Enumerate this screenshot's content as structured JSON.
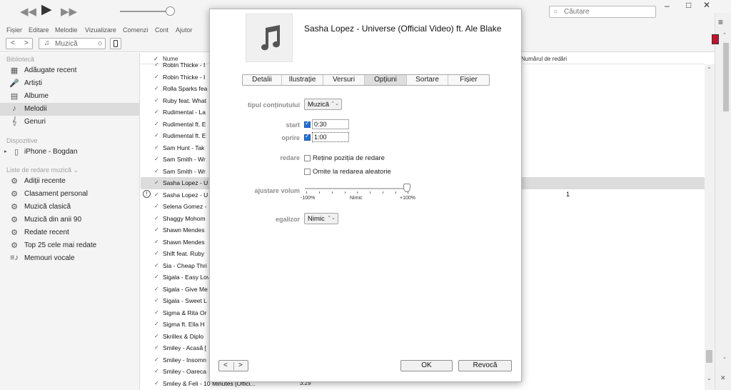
{
  "toolbar": {
    "prev_icon": "◀◀",
    "play_icon": "▶",
    "next_icon": "▶▶",
    "search_placeholder": "Căutare",
    "minimize": "–",
    "maximize": "□",
    "close": "✕"
  },
  "menu": [
    "Fișier",
    "Editare",
    "Melodie",
    "Vizualizare",
    "Comenzi",
    "Cont",
    "Ajutor"
  ],
  "nav": {
    "back": "<",
    "forward": ">",
    "media_select": "Muzică",
    "media_chevron": "◇"
  },
  "sidebar": {
    "library_title": "Bibliotecă",
    "library": [
      {
        "label": "Adăugate recent",
        "icon": "▦"
      },
      {
        "label": "Artiști",
        "icon": "🎤"
      },
      {
        "label": "Albume",
        "icon": "▤"
      },
      {
        "label": "Melodii",
        "icon": "♪"
      },
      {
        "label": "Genuri",
        "icon": "𝄞"
      }
    ],
    "devices_title": "Dispozitive",
    "device": {
      "label": "iPhone - Bogdan",
      "icon": "▯",
      "expand": "▸"
    },
    "playlists_title": "Liste de redare muzică ⌄",
    "playlists": [
      {
        "label": "Adiții recente",
        "icon": "⚙"
      },
      {
        "label": "Clasament personal",
        "icon": "⚙"
      },
      {
        "label": "Muzică clasică",
        "icon": "⚙"
      },
      {
        "label": "Muzică din anii 90",
        "icon": "⚙"
      },
      {
        "label": "Redate recent",
        "icon": "⚙"
      },
      {
        "label": "Top 25 cele mai redate",
        "icon": "⚙"
      },
      {
        "label": "Memouri vocale",
        "icon": "≡♪"
      }
    ]
  },
  "list": {
    "col_check": "✓",
    "col_name": "Nume",
    "col_plays": "Numărul de redări",
    "rows": [
      "Robin Thicke - I",
      "Robin Thicke - I",
      "Rolla Sparks fea",
      "Ruby feat. What",
      "Rudimental - La",
      "Rudimental ft. E",
      "Rudimental ft. E",
      "Sam Hunt - Tak",
      "Sam Smith - Wr",
      "Sam Smith - Wr",
      "Sasha Lopez - U",
      "Sasha Lopez - U",
      "Selena Gomez -",
      "Shaggy Mohom",
      "Shawn Mendes",
      "Shawn Mendes",
      "Shift feat. Ruby",
      "Sia - Cheap Thri",
      "Sigala - Easy Lov",
      "Sigala - Give Me",
      "Sigala - Sweet L",
      "Sigma & Rita Or",
      "Sigma ft. Ella H",
      "Skrillex & Diplo",
      "Smiley - Acasă [",
      "Smiley - Insomn",
      "Smiley - Oareca",
      "Smiley & Feli - 10 Minutes [Offici..."
    ],
    "playcount": "1",
    "last_time": "3:29",
    "warning_icon": "!"
  },
  "dialog": {
    "title": "Sasha Lopez - Universe (Official Video) ft. Ale Blake",
    "tabs": [
      "Detalii",
      "Ilustrație",
      "Versuri",
      "Opțiuni",
      "Sortare",
      "Fișier"
    ],
    "active_tab": "Opțiuni",
    "content_type_label": "tipul conținutului",
    "content_type_value": "Muzică",
    "start_label": "start",
    "start_value": "0:30",
    "start_checked": true,
    "stop_label": "oprire",
    "stop_value": "1:00",
    "stop_checked": true,
    "playback_label": "redare",
    "remember_position": "Reține poziția de redare",
    "skip_shuffle": "Omite la redarea aleatorie",
    "volume_label": "ajustare volum",
    "volume_min": "-100%",
    "volume_mid": "Nimic",
    "volume_max": "+100%",
    "volume_level_fraction": 0.95,
    "eq_label": "egalizor",
    "eq_value": "Nimic",
    "ok": "OK",
    "cancel": "Revocă",
    "prev": "<",
    "next": ">",
    "updown": "⌃⌄"
  },
  "colors": {
    "checkbox_accent": "#1f6fd6",
    "selected_row": "#dcdcdc",
    "badge": "#c8102e"
  }
}
